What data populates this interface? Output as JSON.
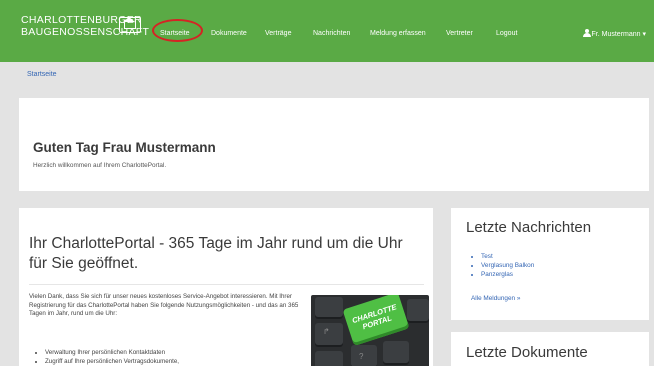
{
  "brand": {
    "line1": "CHARLOTTENBURGER",
    "line2": "BAUGENOSSENSCHAFT"
  },
  "nav": {
    "items": [
      "Startseite",
      "Dokumente",
      "Verträge",
      "Nachrichten",
      "Meldung erfassen",
      "Vertreter",
      "Logout"
    ],
    "user": "Fr. Mustermann",
    "user_caret": "▾"
  },
  "breadcrumb": "Startseite",
  "greeting": {
    "title": "Guten Tag Frau Mustermann",
    "subtitle": "Herzlich willkommen auf Ihrem CharlottePortal."
  },
  "main": {
    "title": "Ihr CharlottePortal - 365 Tage im Jahr rund um die Uhr für Sie geöffnet.",
    "body": "Vielen Dank, dass Sie sich für unser neues kostenloses Service-Angebot interessieren. Mit Ihrer Registrierung für das CharlottePortal haben Sie folgende Nutzungsmöglichkeiten - und das an 365 Tagen im Jahr, rund um die Uhr:",
    "bullets": [
      "Verwaltung Ihrer persönlichen Kontaktdaten",
      "Zugriff auf Ihre persönlichen Vertragsdokumente,"
    ],
    "image_key_text": "CHARLOTTE PORTAL"
  },
  "news": {
    "title": "Letzte Nachrichten",
    "items": [
      "Test",
      "Verglasung Balkon",
      "Panzerglas"
    ],
    "all_link": "Alle Meldungen »"
  },
  "docs": {
    "title": "Letzte Dokumente"
  },
  "colors": {
    "navbar": "#5aaa45",
    "link": "#3466b4",
    "highlight": "#d42424"
  }
}
